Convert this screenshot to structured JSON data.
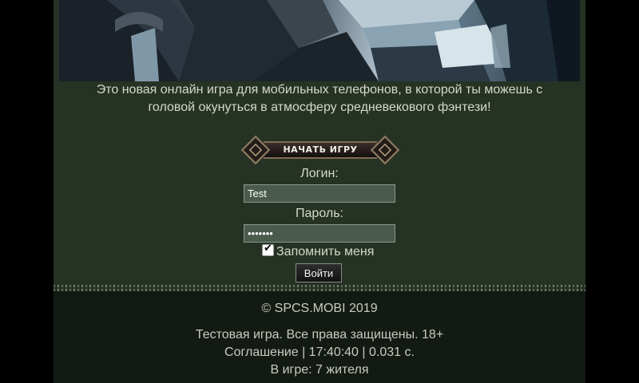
{
  "intro": {
    "line1": "Это новая онлайн игра для мобильных телефонов, в которой ты можешь с",
    "line2": "головой окунуться в атмосферу средневекового фэнтези!"
  },
  "start_button": {
    "label": "НАЧАТЬ ИГРУ"
  },
  "login_form": {
    "login_label": "Логин:",
    "login_value": "Test",
    "password_label": "Пароль:",
    "password_value": "•••••••",
    "remember_label": "Запомнить меня",
    "remember_checked": true,
    "submit_label": "Войти"
  },
  "footer": {
    "copyright": "© SPCS.MOBI 2019",
    "rights": "Тестовая игра. Все права защищены. 18+",
    "agreement_link": "Соглашение",
    "separator1": " | ",
    "time": "17:40:40",
    "separator2": " | ",
    "load_time": "0.031 с.",
    "online": "В игре: 7 жителя"
  },
  "colors": {
    "page_background": "#000000",
    "content_background": "#263324",
    "footer_background": "#131a14",
    "text": "#d6d8c8"
  }
}
